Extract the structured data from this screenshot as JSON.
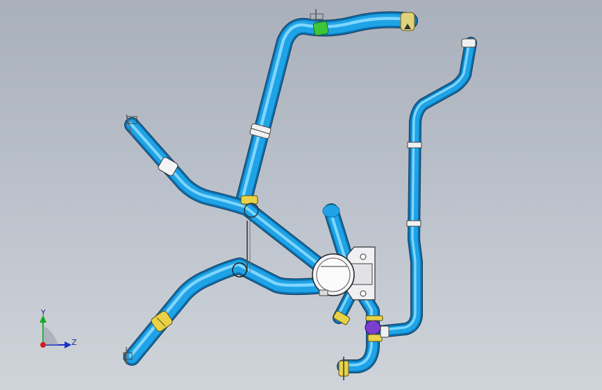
{
  "viewport": {
    "model": "pipe-assembly",
    "view": "isometric",
    "background_gradient": [
      "#a9b0bb",
      "#cfd4da"
    ]
  },
  "colors": {
    "pipe": "#1fa3e6",
    "pipe_highlight": "#7fd6ff",
    "pipe_shadow": "#0b6fae",
    "clamp_yellow": "#e8d24a",
    "clamp_green": "#3ec63a",
    "fitting_purple": "#7b3fd0",
    "bracket_grey": "#e8e8ec"
  },
  "triad": {
    "y_label": "Y",
    "z_label": "Z",
    "y_color": "#19a82a",
    "z_color": "#1a34c9",
    "x_color": "#d41a1a"
  }
}
